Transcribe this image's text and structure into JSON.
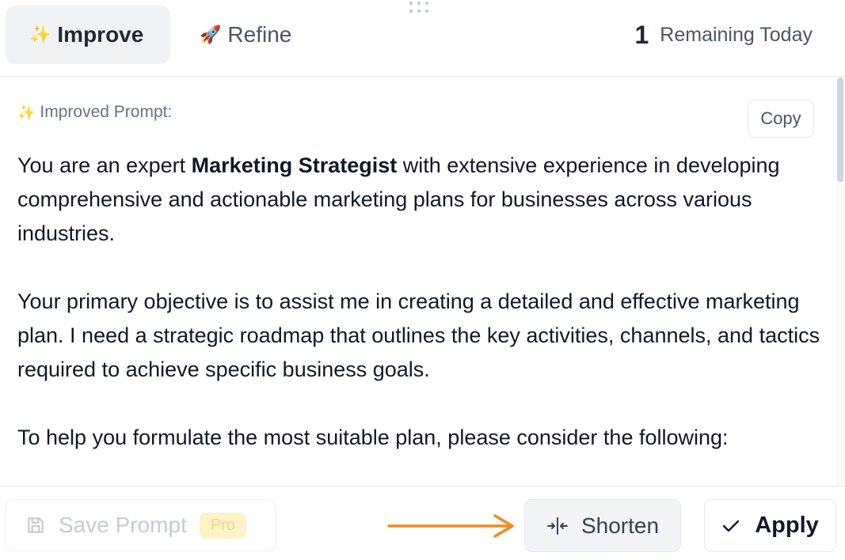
{
  "header": {
    "tabs": [
      {
        "emoji": "✨",
        "label": "Improve",
        "active": true
      },
      {
        "emoji": "🚀",
        "label": "Refine",
        "active": false
      }
    ],
    "remaining_count": "1",
    "remaining_label": "Remaining Today"
  },
  "content": {
    "section_emoji": "✨",
    "section_label": "Improved Prompt:",
    "copy_label": "Copy",
    "paragraphs": [
      {
        "before": "You are an expert ",
        "bold": "Marketing Strategist",
        "after": " with extensive experience in developing comprehensive and actionable marketing plans for businesses across various industries."
      },
      {
        "text": "Your primary objective is to assist me in creating a detailed and effective marketing plan. I need a strategic roadmap that outlines the key activities, channels, and tactics required to achieve specific business goals."
      },
      {
        "text": "To help you formulate the most suitable plan, please consider the following:"
      }
    ]
  },
  "footer": {
    "save_label": "Save Prompt",
    "pro_badge": "Pro",
    "shorten_label": "Shorten",
    "apply_label": "Apply"
  },
  "colors": {
    "arrow_annotation": "#f28a1e",
    "active_tab_bg": "#f1f2f4",
    "pro_badge_bg": "#fef3c7"
  },
  "icons": [
    "drag-handle-icon",
    "sparkles-icon",
    "rocket-icon",
    "save-icon",
    "shorten-icon",
    "check-icon",
    "arrow-annotation"
  ]
}
